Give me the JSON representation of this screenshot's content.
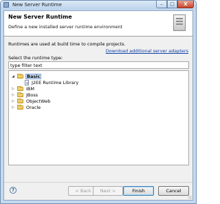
{
  "window": {
    "title": "New Server Runtime"
  },
  "banner": {
    "title": "New Server Runtime",
    "description": "Define a new installed server runtime environment"
  },
  "content": {
    "info": "Runtimes are used at build time to compile projects.",
    "download_link": "Download additional server adapters",
    "select_label": "Select the runtime type:",
    "filter_value": "type filter text"
  },
  "tree": {
    "items": [
      {
        "label": "Basic",
        "expanded": true,
        "selected": true
      },
      {
        "label": "J2EE Runtime Library",
        "child": true
      },
      {
        "label": "IBM",
        "expanded": false
      },
      {
        "label": "JBoss",
        "expanded": false
      },
      {
        "label": "ObjectWeb",
        "expanded": false
      },
      {
        "label": "Oracle",
        "expanded": false
      }
    ]
  },
  "buttons": {
    "help": "?",
    "back": "< Back",
    "next": "Next >",
    "finish": "Finish",
    "cancel": "Cancel"
  },
  "titlebar_buttons": {
    "minimize": "–",
    "maximize": "□",
    "close": "X"
  }
}
